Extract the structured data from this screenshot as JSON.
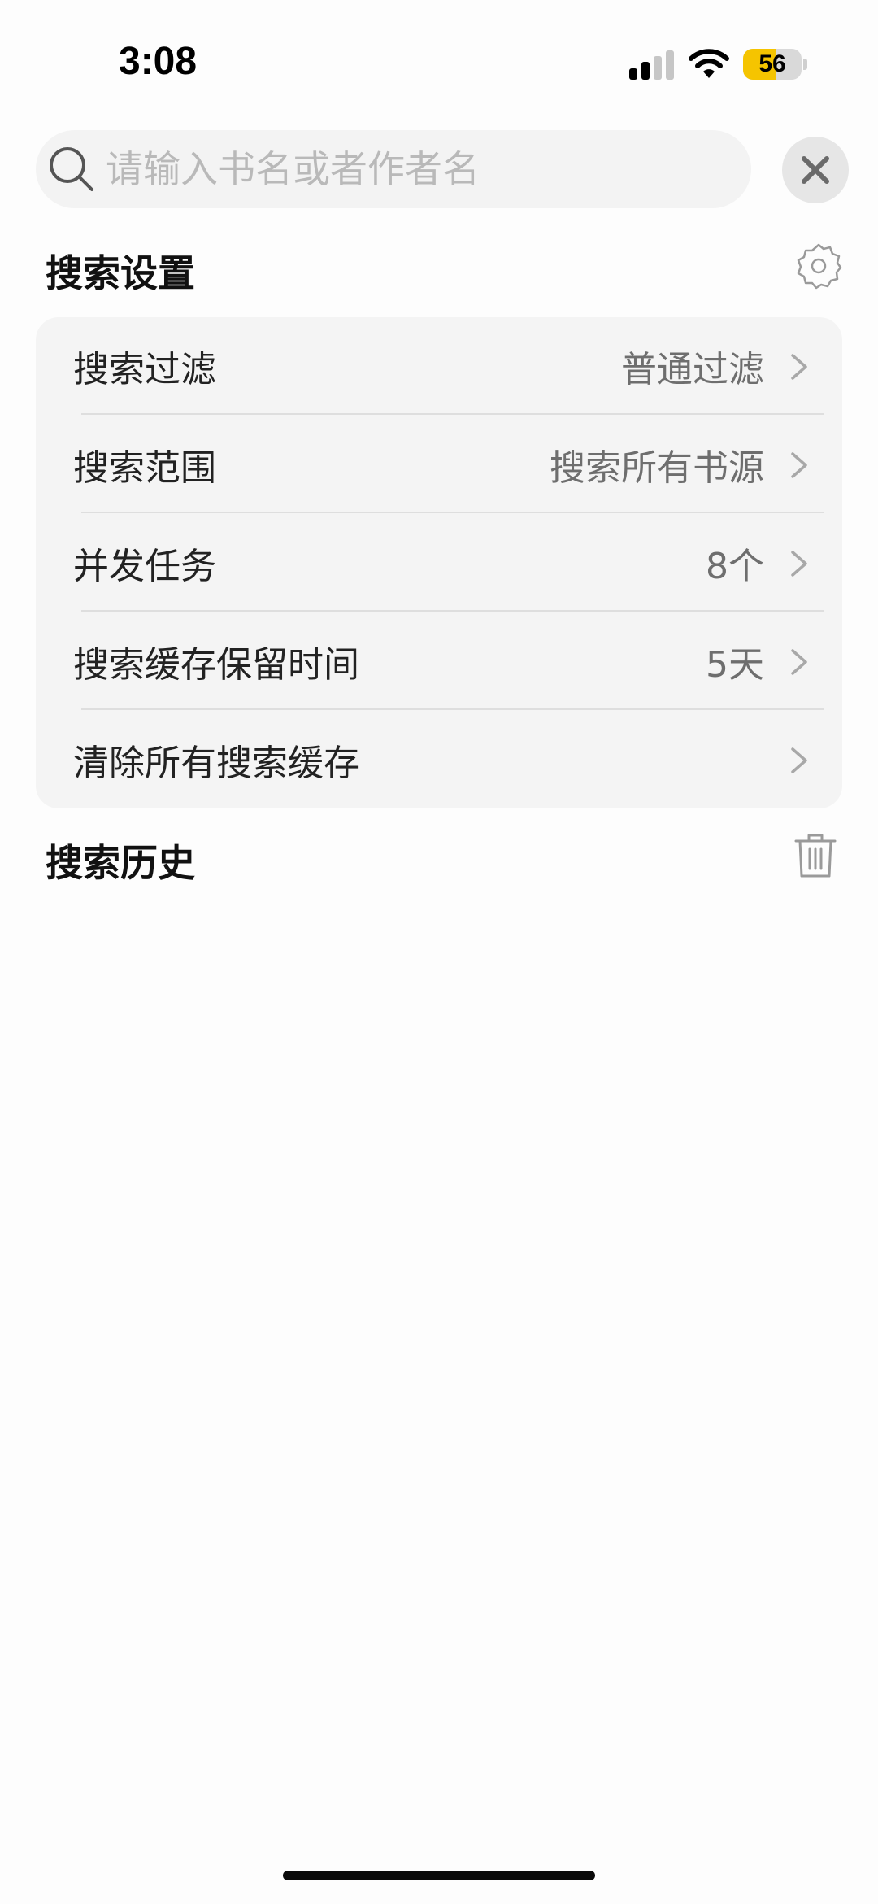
{
  "status_bar": {
    "time": "3:08",
    "battery_level": "56",
    "battery_color": "#f5c400",
    "signal_icon": "cellular-signal-icon",
    "wifi_icon": "wifi-icon"
  },
  "search": {
    "placeholder": "请输入书名或者作者名",
    "value": "",
    "search_icon": "search-icon",
    "close_icon": "close-icon"
  },
  "settings_section": {
    "title": "搜索设置",
    "icon": "gear-icon",
    "rows": [
      {
        "label": "搜索过滤",
        "value": "普通过滤"
      },
      {
        "label": "搜索范围",
        "value": "搜索所有书源"
      },
      {
        "label": "并发任务",
        "value": "8个"
      },
      {
        "label": "搜索缓存保留时间",
        "value": "5天"
      },
      {
        "label": "清除所有搜索缓存",
        "value": ""
      }
    ]
  },
  "history_section": {
    "title": "搜索历史",
    "icon": "trash-icon"
  }
}
